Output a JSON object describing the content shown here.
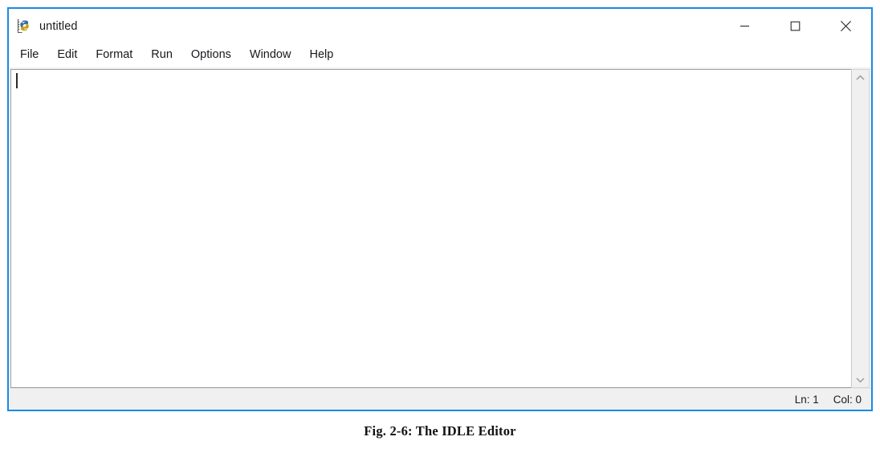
{
  "window": {
    "title": "untitled",
    "icon": "python-idle-icon",
    "border_color": "#1b8ae2",
    "controls": [
      {
        "name": "minimize-button",
        "glyph": "minimize-icon",
        "label": "Minimize"
      },
      {
        "name": "maximize-button",
        "glyph": "maximize-icon",
        "label": "Maximize"
      },
      {
        "name": "close-button",
        "glyph": "close-icon",
        "label": "Close"
      }
    ]
  },
  "menu": {
    "items": [
      {
        "label": "File"
      },
      {
        "label": "Edit"
      },
      {
        "label": "Format"
      },
      {
        "label": "Run"
      },
      {
        "label": "Options"
      },
      {
        "label": "Window"
      },
      {
        "label": "Help"
      }
    ]
  },
  "editor": {
    "content": "",
    "caret_visible": true,
    "scrollbar": {
      "up_arrow": "chevron-up-icon",
      "down_arrow": "chevron-down-icon",
      "thumb_visible": false
    }
  },
  "status_bar": {
    "line": "Ln: 1",
    "column": "Col: 0"
  },
  "figure": {
    "caption": "Fig. 2-6: The IDLE Editor"
  }
}
